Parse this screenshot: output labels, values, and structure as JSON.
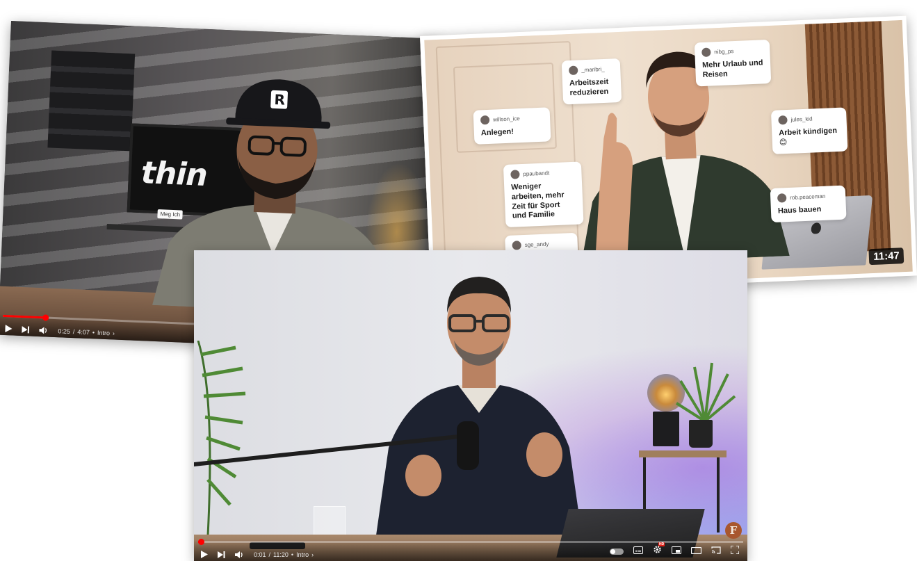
{
  "player_top_left": {
    "frame_text": "thin",
    "shelf_label": "Meg Ich",
    "time_current": "0:25",
    "time_total": "4:07",
    "chapter": "Intro",
    "progress": 0.1
  },
  "player_top_right": {
    "duration": "11:47",
    "comments": [
      {
        "user": "_maribri_",
        "text": "Arbeitszeit reduzieren"
      },
      {
        "user": "nibg_ps",
        "text": "Mehr Urlaub und Reisen"
      },
      {
        "user": "willson_ice",
        "text": "Anlegen!"
      },
      {
        "user": "jules_kid",
        "text": "Arbeit kündigen 😊"
      },
      {
        "user": "ppaubandt",
        "text": "Weniger arbeiten, mehr Zeit für Sport und Familie"
      },
      {
        "user": "rob.peaceman",
        "text": "Haus bauen"
      },
      {
        "user": "sge_andy",
        "text": ""
      }
    ]
  },
  "player_bottom": {
    "time_current": "0:01",
    "time_total": "11:20",
    "chapter": "Intro",
    "progress": 0.005,
    "channel_badge": "F"
  },
  "colors": {
    "progress_red": "#ff0000",
    "duration_badge": "#000000"
  }
}
